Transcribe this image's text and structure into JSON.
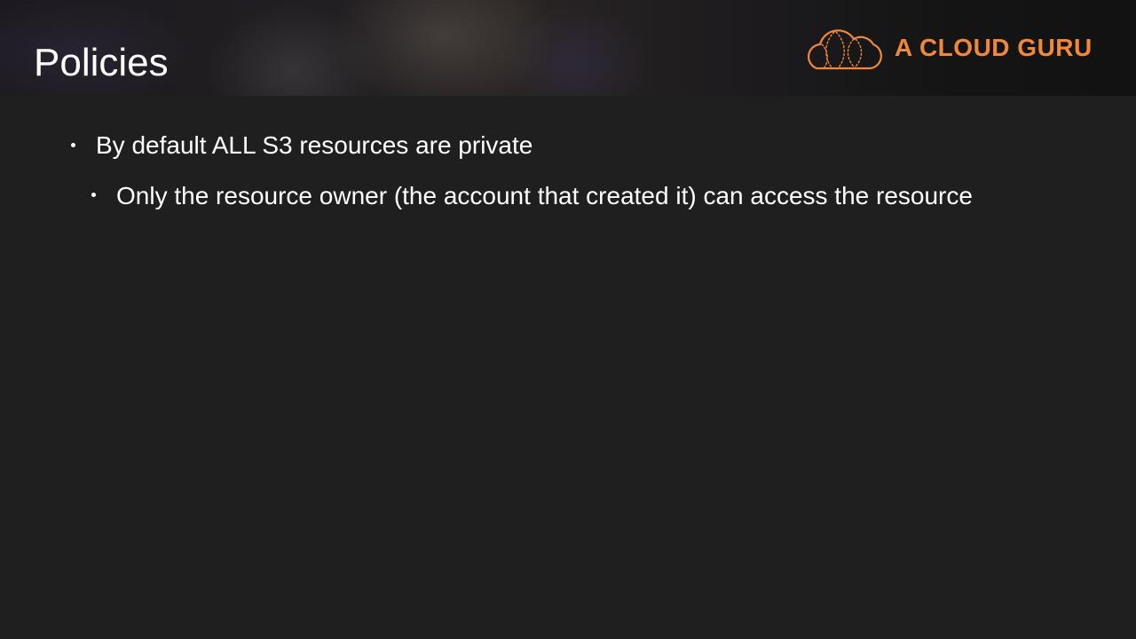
{
  "slide": {
    "title": "Policies",
    "brand": {
      "name": "A CLOUD GURU",
      "icon": "cloud-logo-icon",
      "color": "#f0883a"
    },
    "bullets": [
      {
        "level": 1,
        "text": "By default ALL S3 resources are private"
      },
      {
        "level": 2,
        "text": "Only the resource owner (the account that created it) can access the resource"
      }
    ]
  },
  "colors": {
    "background": "#1f1f1f",
    "text": "#ffffff",
    "accent": "#f0883a"
  }
}
